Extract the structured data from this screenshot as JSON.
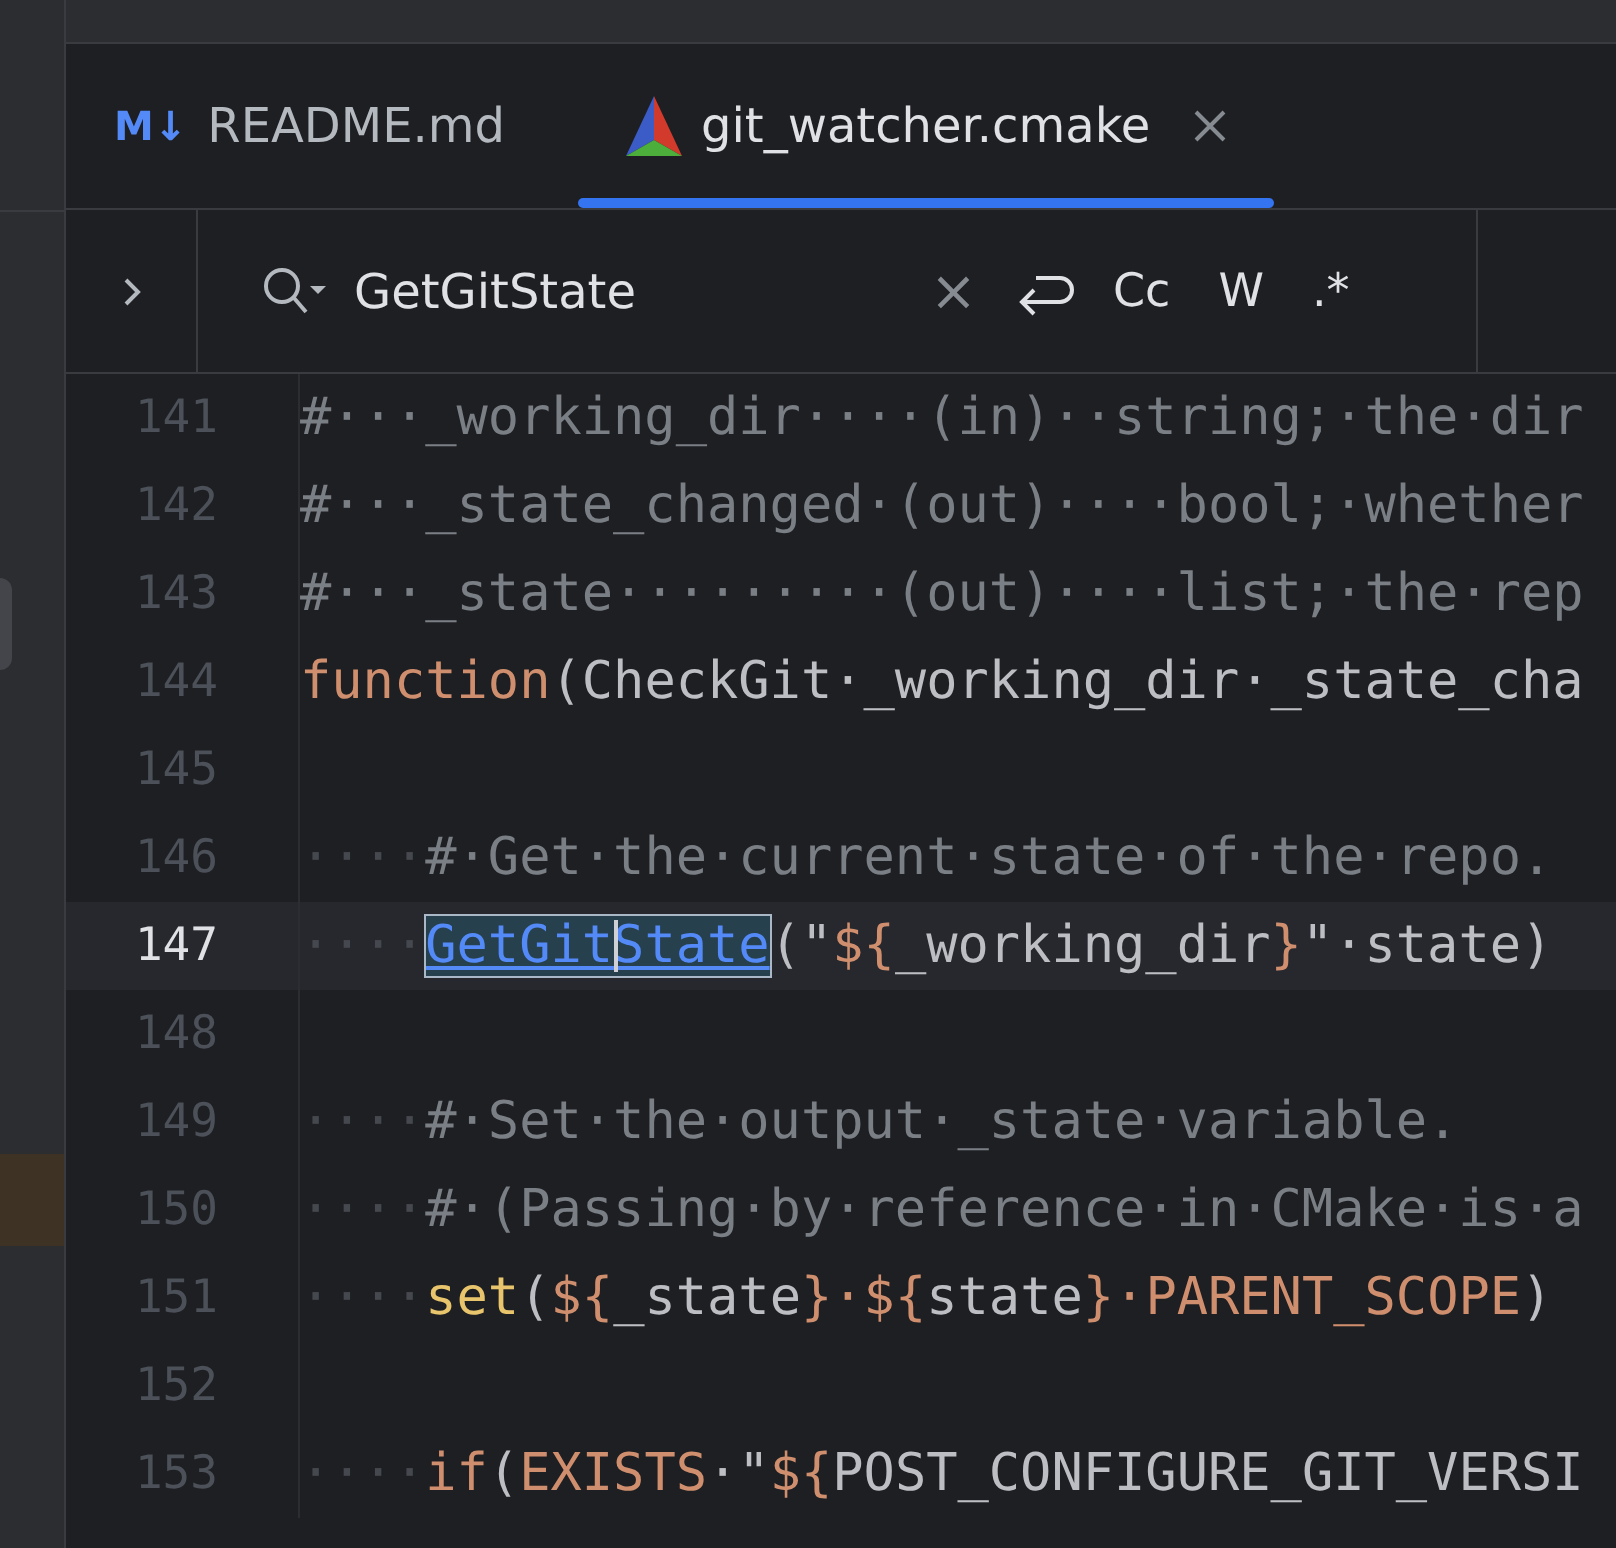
{
  "tabs": [
    {
      "label": "README.md",
      "badge": "M↓",
      "kind": "markdown",
      "selected": false,
      "closable": false
    },
    {
      "label": "git_watcher.cmake",
      "kind": "cmake",
      "selected": true,
      "closable": true
    }
  ],
  "search": {
    "value": "GetGitState",
    "clear": "×",
    "options": [
      "Cc",
      "W",
      ".*"
    ]
  },
  "lines": [
    {
      "number": "141",
      "current": false,
      "tokens": [
        {
          "kind": "comment",
          "text": "#···_working_dir····(in)··string;·the·dir"
        }
      ]
    },
    {
      "number": "142",
      "current": false,
      "tokens": [
        {
          "kind": "comment",
          "text": "#···_state_changed·(out)····bool;·whether"
        }
      ]
    },
    {
      "number": "143",
      "current": false,
      "tokens": [
        {
          "kind": "comment",
          "text": "#···_state·········(out)····list;·the·rep"
        }
      ]
    },
    {
      "number": "144",
      "current": false,
      "tokens": [
        {
          "kind": "keyword",
          "text": "function"
        },
        {
          "kind": "text",
          "text": "(CheckGit·_working_dir·_state_cha"
        }
      ]
    },
    {
      "number": "145",
      "current": false
    },
    {
      "number": "146",
      "current": false,
      "tokens": [
        {
          "kind": "ws",
          "text": "····"
        },
        {
          "kind": "comment",
          "text": "#·Get·the·current·state·of·the·repo."
        }
      ]
    },
    {
      "number": "147",
      "current": true,
      "tokens": [
        {
          "kind": "ws",
          "text": "····"
        },
        {
          "kind": "match",
          "text": "GetGitState"
        },
        {
          "kind": "text",
          "text": "(\""
        },
        {
          "kind": "var",
          "text": "${"
        },
        {
          "kind": "text",
          "text": "_working_dir"
        },
        {
          "kind": "var",
          "text": "}"
        },
        {
          "kind": "text",
          "text": "\"·state)"
        }
      ]
    },
    {
      "number": "148",
      "current": false
    },
    {
      "number": "149",
      "current": false,
      "tokens": [
        {
          "kind": "ws",
          "text": "····"
        },
        {
          "kind": "comment",
          "text": "#·Set·the·output·_state·variable."
        }
      ]
    },
    {
      "number": "150",
      "current": false,
      "tokens": [
        {
          "kind": "ws",
          "text": "····"
        },
        {
          "kind": "comment",
          "text": "#·(Passing·by·reference·in·CMake·is·a"
        }
      ]
    },
    {
      "number": "151",
      "current": false,
      "tokens": [
        {
          "kind": "ws",
          "text": "····"
        },
        {
          "kind": "command",
          "text": "set"
        },
        {
          "kind": "text",
          "text": "("
        },
        {
          "kind": "var",
          "text": "${"
        },
        {
          "kind": "text",
          "text": "_state"
        },
        {
          "kind": "var",
          "text": "}·${"
        },
        {
          "kind": "text",
          "text": "state"
        },
        {
          "kind": "var",
          "text": "}·PARENT_SCOPE"
        },
        {
          "kind": "text",
          "text": ")"
        }
      ]
    },
    {
      "number": "152",
      "current": false
    },
    {
      "number": "153",
      "current": false,
      "tokens": [
        {
          "kind": "ws",
          "text": "····"
        },
        {
          "kind": "keyword",
          "text": "if"
        },
        {
          "kind": "text",
          "text": "("
        },
        {
          "kind": "var",
          "text": "EXISTS"
        },
        {
          "kind": "text",
          "text": "·\""
        },
        {
          "kind": "var",
          "text": "${"
        },
        {
          "kind": "text",
          "text": "POST_CONFIGURE_GIT_VERSI"
        }
      ]
    }
  ]
}
